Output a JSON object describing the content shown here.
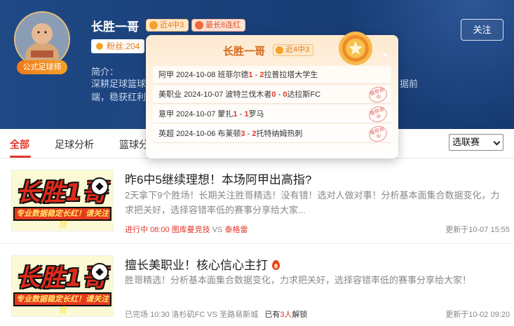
{
  "profile": {
    "name": "长胜一哥",
    "role_badge": "公式足球师",
    "record_tag": "近4中3",
    "streak_tag": "最长8连红",
    "fans_label": "粉丝:204",
    "intro_label": "简介：",
    "intro_text": "深耕足球篮球",
    "intro_line2": "端，稳获红利",
    "intro_tail": "据前",
    "follow_label": "关注"
  },
  "popup": {
    "name": "长胜一哥",
    "record_tag": "近4中3",
    "results": [
      {
        "league": "阿甲",
        "date": "2024-10-08",
        "home": "班菲尔德",
        "home_score": "1",
        "away_score": "2",
        "away": "拉普拉塔大学生",
        "stamp": ""
      },
      {
        "league": "美职业",
        "date": "2024-10-07",
        "home": "波特兰伐木者",
        "home_score": "0",
        "away_score": "0",
        "away": "达拉斯FC",
        "stamp": "推荐命中"
      },
      {
        "league": "意甲",
        "date": "2024-10-07",
        "home": "蒙扎",
        "home_score": "1",
        "away_score": "1",
        "away": "罗马",
        "stamp": "推荐命中"
      },
      {
        "league": "英超",
        "date": "2024-10-06",
        "home": "布莱顿",
        "home_score": "3",
        "away_score": "2",
        "away": "托特纳姆热刺",
        "stamp": "推荐命中"
      }
    ]
  },
  "tabs": [
    {
      "label": "全部",
      "active": true
    },
    {
      "label": "足球分析",
      "active": false
    },
    {
      "label": "篮球分",
      "active": false
    }
  ],
  "league_select": {
    "selected": "选联赛"
  },
  "articles": [
    {
      "thumb_title": "长胜1哥",
      "thumb_strip": "专业数据稳定长红！请关注我",
      "title": "昨6中5继续理想！本场阿甲出高指?",
      "body": "2天拿下9个胜场！长期关注胜哥精选！没有错！选对人做对事！分析基本面集合数据变化，力求把关好，选择容错率低的赛事分享给大家...",
      "status": "进行中",
      "match_time": "08:00",
      "home": "图库曼竞技",
      "vs": "VS",
      "away": "泰格雷",
      "updated": "更新于10-07 15:55"
    },
    {
      "thumb_title": "长胜1哥",
      "thumb_strip": "专业数据稳定长红！请关注我",
      "title": "擅长美职业！核心信心主打",
      "body": "胜哥精选！分析基本面集合数据变化，力求把关好，选择容错率低的赛事分享给大家！",
      "status": "已完场",
      "match_time": "10:30",
      "home": "洛杉矶FC",
      "vs": "VS",
      "away": "圣路易斯城",
      "unlock_prefix": "已有",
      "unlock_count": "3人",
      "unlock_suffix": "解锁",
      "updated": "更新于10-02 09:20"
    }
  ]
}
